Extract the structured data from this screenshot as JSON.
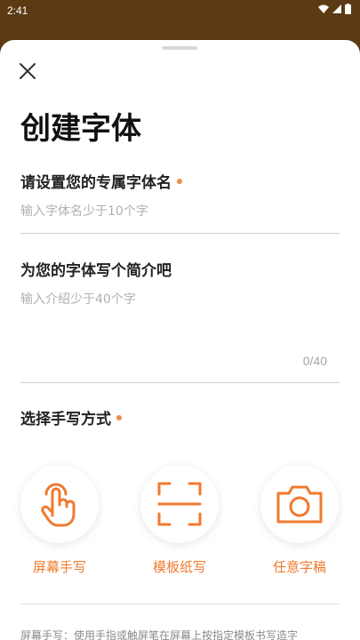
{
  "status_bar": {
    "time": "2:41"
  },
  "sheet": {
    "title": "创建字体",
    "name_section": {
      "label": "请设置您的专属字体名",
      "placeholder": "输入字体名少于10个字"
    },
    "intro_section": {
      "label": "为您的字体写个简介吧",
      "placeholder": "输入介绍少于40个字",
      "counter": "0/40"
    },
    "method_section": {
      "label": "选择手写方式",
      "options": [
        {
          "label": "屏幕手写",
          "icon": "finger-touch-icon"
        },
        {
          "label": "模板纸写",
          "icon": "scan-frame-icon"
        },
        {
          "label": "任意字稿",
          "icon": "camera-icon"
        }
      ]
    },
    "footer_note": "屏幕手写：使用手指或触屏笔在屏幕上按指定模板书写造字"
  },
  "colors": {
    "accent": "#f07a2e",
    "dot": "#f08a4b",
    "backdrop": "#5b3a14"
  }
}
